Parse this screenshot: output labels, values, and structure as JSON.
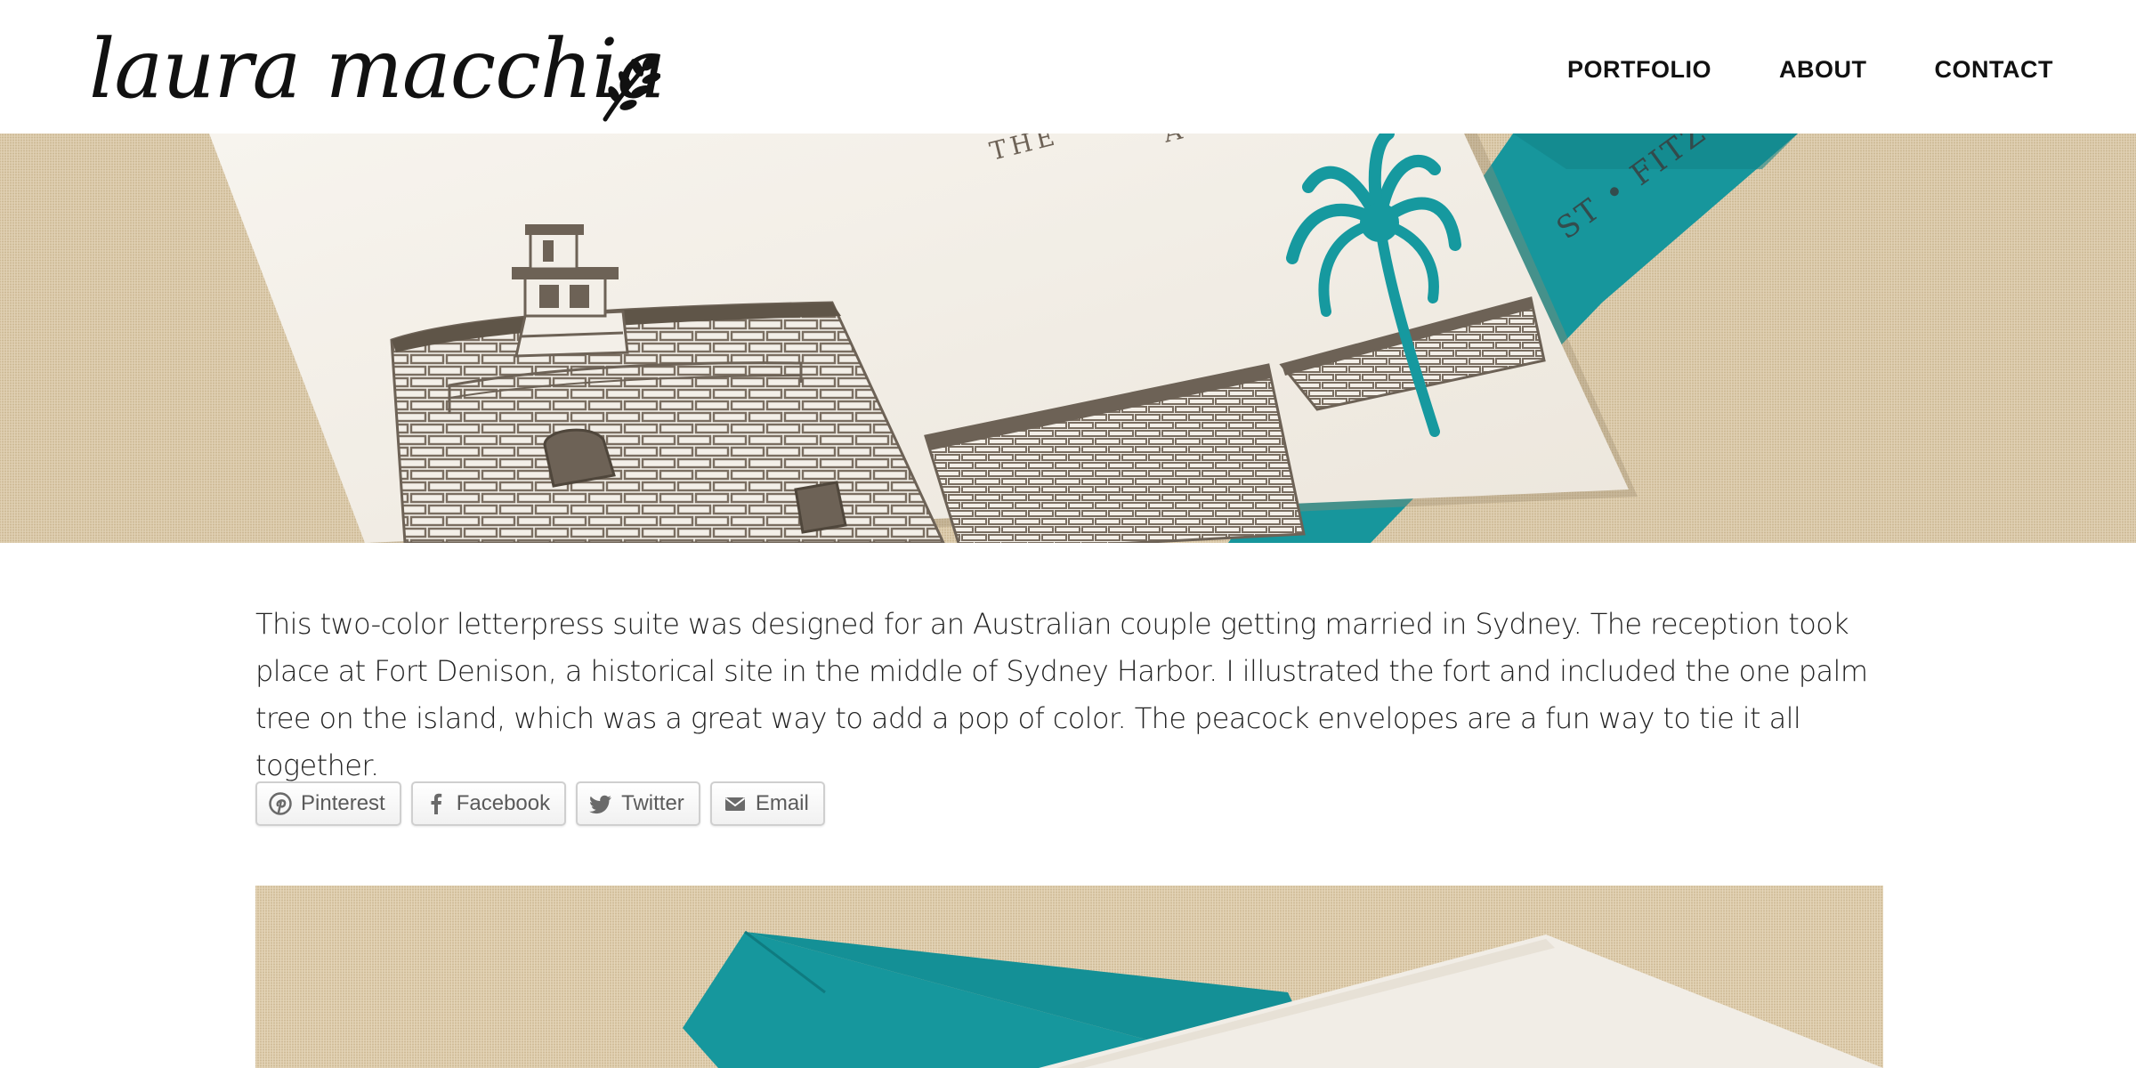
{
  "header": {
    "logo_text": "laura macchia",
    "nav": [
      {
        "label": "PORTFOLIO"
      },
      {
        "label": "ABOUT"
      },
      {
        "label": "CONTACT"
      }
    ]
  },
  "hero": {
    "alt": "",
    "visible_card_text": [
      "THE",
      "A",
      "ST • FITZ"
    ]
  },
  "description": "This two-color letterpress suite was designed for an Australian couple getting married in Sydney. The reception took place at Fort Denison, a historical site in the middle of Sydney Harbor. I illustrated the fort and included the one palm tree on the island, which was a great way to add a pop of color. The peacock envelopes are a fun way to tie it all together.",
  "share": {
    "buttons": [
      {
        "label": "Pinterest",
        "icon": "pinterest-icon"
      },
      {
        "label": "Facebook",
        "icon": "facebook-icon"
      },
      {
        "label": "Twitter",
        "icon": "twitter-icon"
      },
      {
        "label": "Email",
        "icon": "email-icon"
      }
    ]
  },
  "colors": {
    "linen": "#d8c7a7",
    "teal": "#16999f",
    "card": "#f4f0e8",
    "ink_brown": "#6d6256",
    "text": "#222222"
  }
}
